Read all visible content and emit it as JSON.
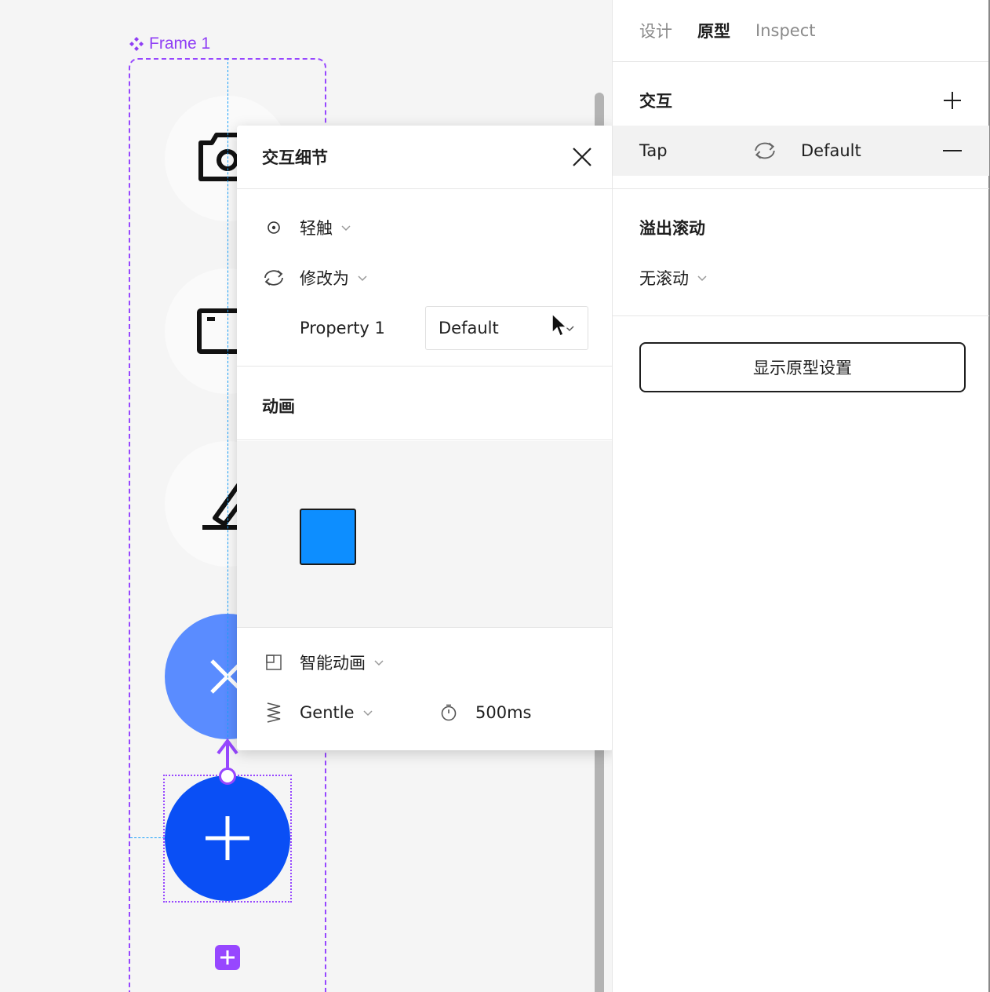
{
  "canvas": {
    "frame_label": "Frame 1"
  },
  "popover": {
    "title": "交互细节",
    "trigger": {
      "label": "轻触",
      "icon": "tap-target-icon"
    },
    "action": {
      "label": "修改为",
      "icon": "change-to-icon"
    },
    "property": {
      "label": "Property 1",
      "value": "Default"
    },
    "animation_title": "动画",
    "animation_type": {
      "label": "智能动画",
      "icon": "smart-animate-icon"
    },
    "easing": {
      "label": "Gentle",
      "icon": "spring-icon"
    },
    "duration": {
      "label": "500ms",
      "icon": "timer-icon"
    }
  },
  "panel": {
    "tabs": [
      {
        "label": "设计",
        "active": false
      },
      {
        "label": "原型",
        "active": true
      },
      {
        "label": "Inspect",
        "active": false
      }
    ],
    "interactions": {
      "title": "交互",
      "item": {
        "trigger": "Tap",
        "target": "Default"
      }
    },
    "overflow": {
      "title": "溢出滚动",
      "value": "无滚动"
    },
    "show_proto_button": "显示原型设置"
  },
  "colors": {
    "accent_purple": "#9747ff",
    "blue_primary": "#0a4ff5",
    "blue_light": "#5a8cff",
    "guide_blue": "#18a0fb",
    "preview_box": "#0d8eff"
  }
}
